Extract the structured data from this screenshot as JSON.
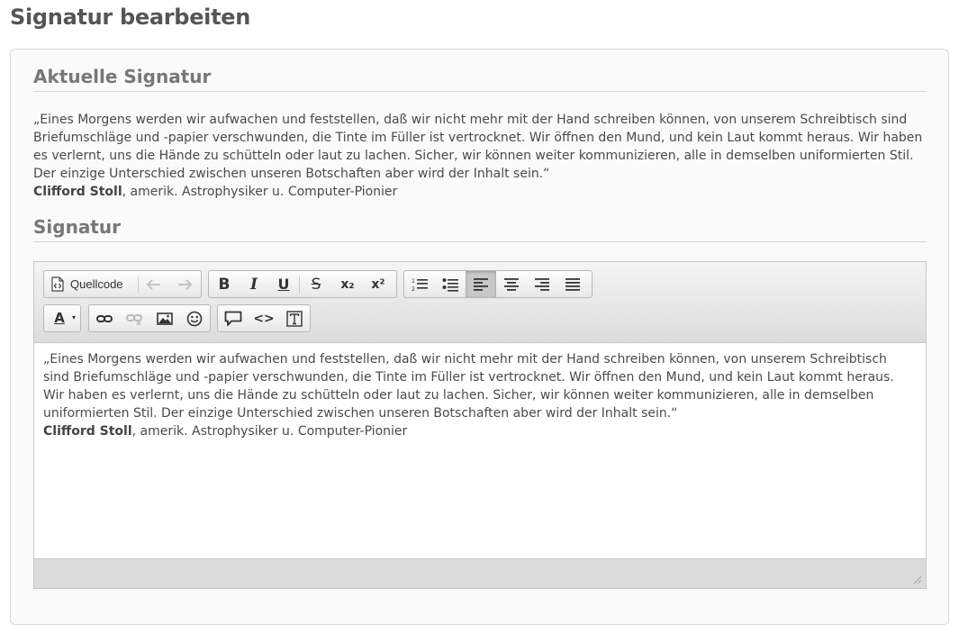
{
  "page": {
    "title": "Signatur bearbeiten"
  },
  "current": {
    "heading": "Aktuelle Signatur",
    "quote": "„Eines Morgens werden wir aufwachen und feststellen, daß wir nicht mehr mit der Hand schreiben können, von unserem Schreibtisch sind Briefumschläge und -papier verschwunden, die Tinte im Füller ist vertrocknet. Wir öffnen den Mund, und kein Laut kommt heraus. Wir haben es verlernt, uns die Hände zu schütteln oder laut zu lachen. Sicher, wir können weiter kommunizieren, alle in demselben uniformierten Stil. Der einzige Unterschied zwischen unseren Botschaften aber wird der Inhalt sein.“",
    "author": "Clifford Stoll",
    "author_desc": ", amerik. Astrophysiker u. Computer-Pionier"
  },
  "signature": {
    "heading": "Signatur",
    "toolbar": {
      "source_label": "Quellcode",
      "bold": "B",
      "italic": "I",
      "underline": "U",
      "strike": "S",
      "subscript": "x₂",
      "superscript": "x²",
      "text_color": "A",
      "code": "<>",
      "active_alignment": "left"
    },
    "editor_quote": "„Eines Morgens werden wir aufwachen und feststellen, daß wir nicht mehr mit der Hand schreiben können, von unserem Schreibtisch sind Briefumschläge und -papier verschwunden, die Tinte im Füller ist vertrocknet. Wir öffnen den Mund, und kein Laut kommt heraus. Wir haben es verlernt, uns die Hände zu schütteln oder laut zu lachen. Sicher, wir können weiter kommunizieren, alle in demselben uniformierten Stil. Der einzige Unterschied zwischen unseren Botschaften aber wird der Inhalt sein.“",
    "editor_author": "Clifford Stoll",
    "editor_author_desc": ", amerik. Astrophysiker u. Computer-Pionier"
  },
  "colors": {
    "text": "#555555",
    "toolbar_bg": "#e4e4e4",
    "active_button": "#c8c8c8"
  }
}
